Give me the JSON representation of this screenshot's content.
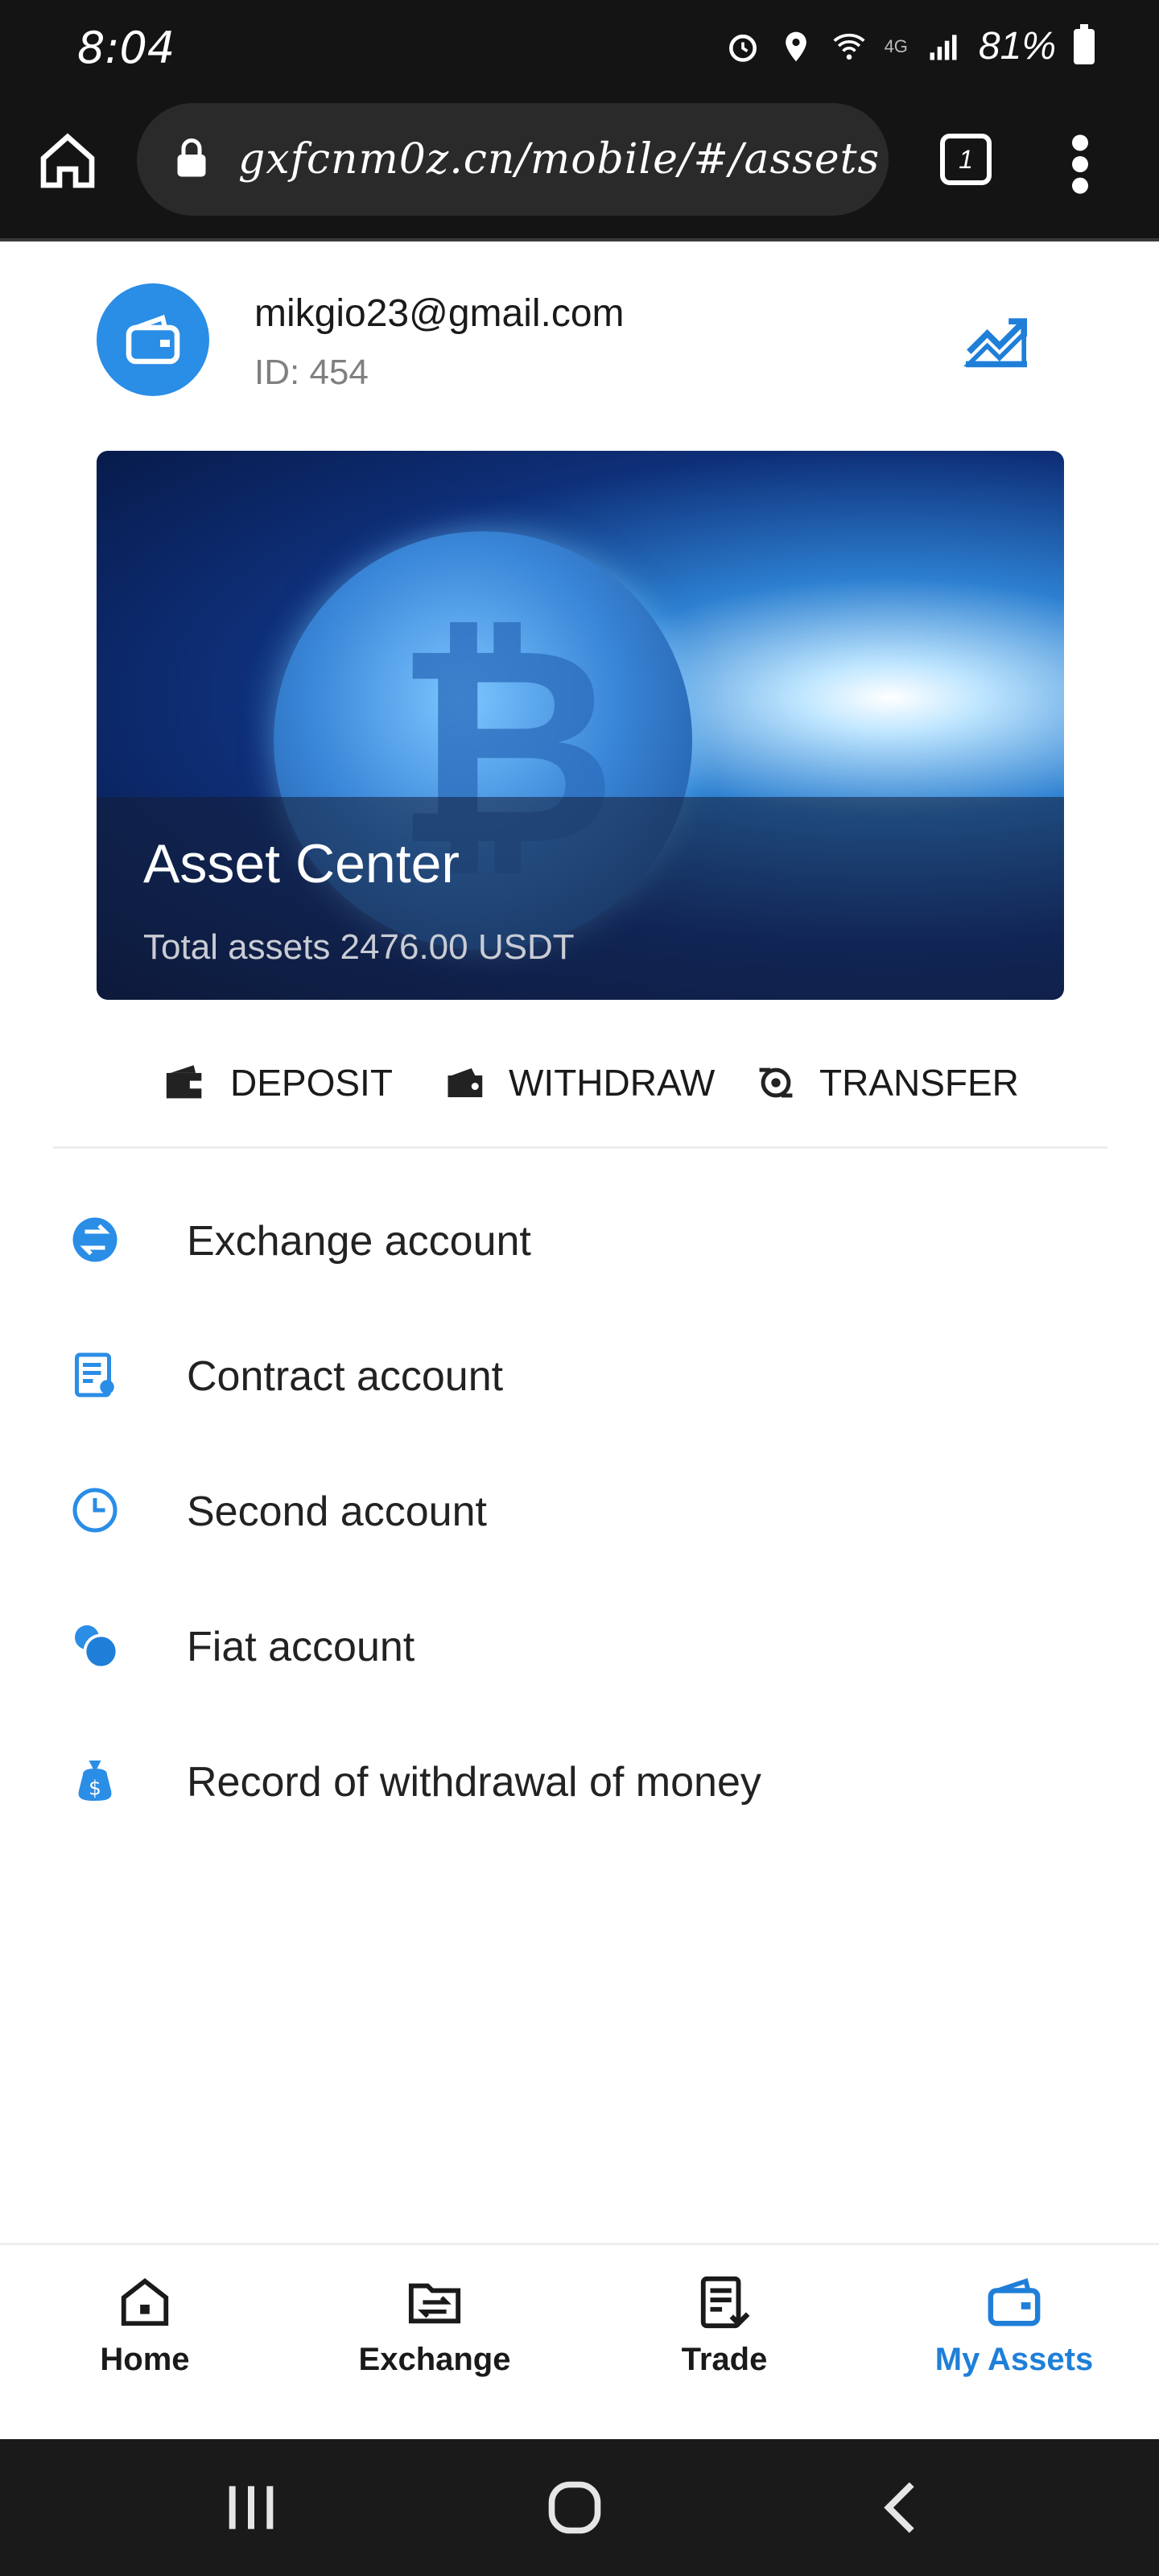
{
  "status_bar": {
    "time": "8:04",
    "network": "4G",
    "battery": "81%"
  },
  "browser": {
    "url": "gxfcnm0z.cn/mobile/#/assets",
    "tab_count": "1"
  },
  "profile": {
    "email": "mikgio23@gmail.com",
    "id_text": "ID: 454"
  },
  "banner": {
    "title": "Asset Center",
    "total": "Total assets 2476.00 USDT"
  },
  "actions": {
    "deposit": "DEPOSIT",
    "withdraw": "WITHDRAW",
    "transfer": "TRANSFER"
  },
  "accounts": [
    {
      "label": "Exchange account",
      "icon": "exchange-icon"
    },
    {
      "label": "Contract account",
      "icon": "contract-icon"
    },
    {
      "label": "Second account",
      "icon": "clock-icon"
    },
    {
      "label": "Fiat account",
      "icon": "coins-icon"
    },
    {
      "label": "Record of withdrawal of money",
      "icon": "money-bag-icon"
    }
  ],
  "bottom_nav": [
    {
      "label": "Home",
      "icon": "home-icon",
      "active": false
    },
    {
      "label": "Exchange",
      "icon": "exchange-folder-icon",
      "active": false
    },
    {
      "label": "Trade",
      "icon": "trade-icon",
      "active": false
    },
    {
      "label": "My Assets",
      "icon": "wallet-icon",
      "active": true
    }
  ],
  "colors": {
    "accent": "#1f7fd8",
    "avatar": "#2a8de6",
    "bar_bg": "#141414"
  }
}
